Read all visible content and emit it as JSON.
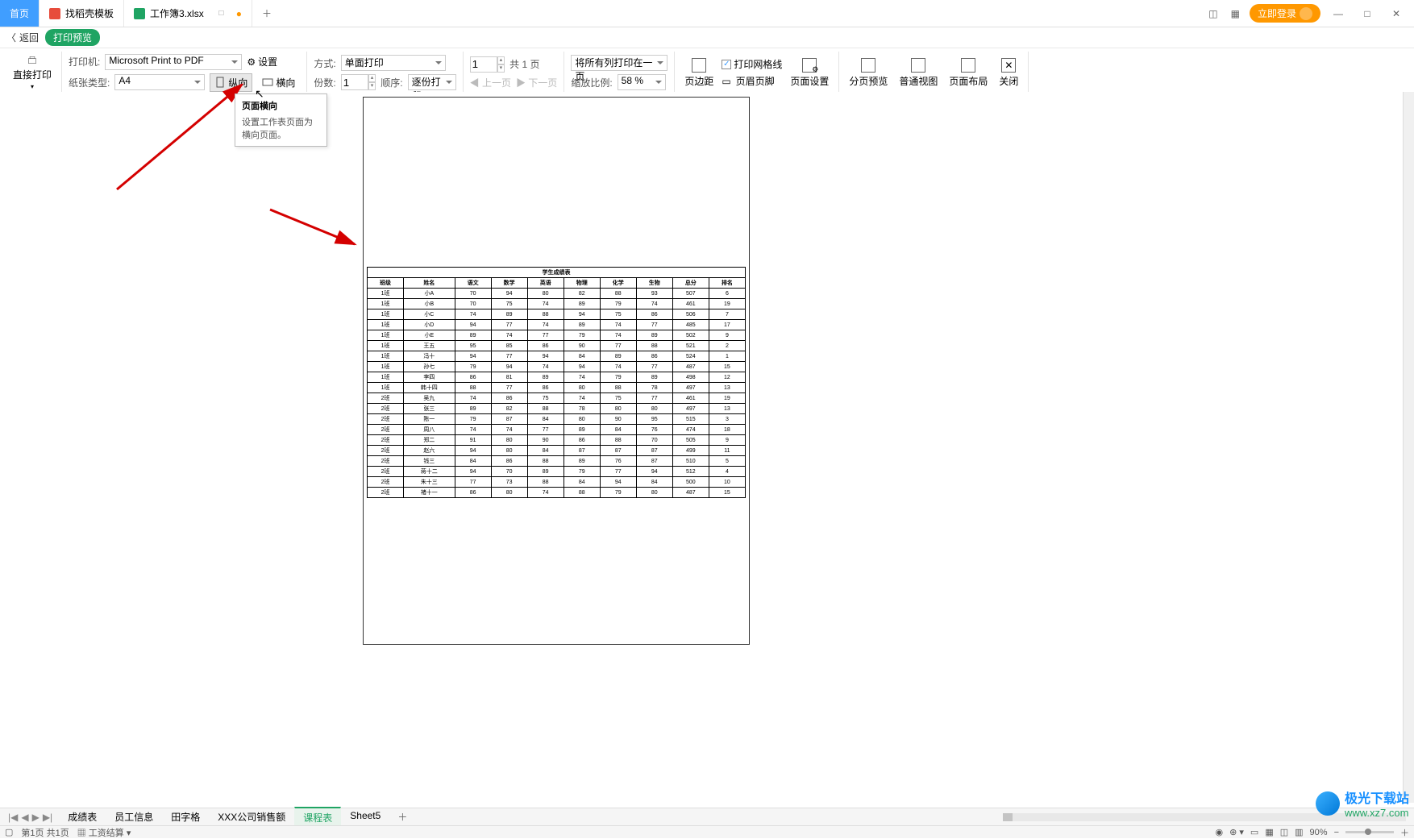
{
  "tabs": {
    "home": "首页",
    "template": "找稻壳模板",
    "file": "工作簿3.xlsx"
  },
  "titlebar": {
    "login": "立即登录"
  },
  "subbar": {
    "back": "返回",
    "title": "打印预览"
  },
  "toolbar": {
    "direct_print": "直接打印",
    "printer_label": "打印机:",
    "printer_value": "Microsoft Print to PDF",
    "paper_label": "纸张类型:",
    "paper_value": "A4",
    "settings": "设置",
    "portrait": "纵向",
    "landscape": "横向",
    "method_label": "方式:",
    "method_value": "单面打印",
    "copies_label": "份数:",
    "copies_value": "1",
    "order_label": "顺序:",
    "order_value": "逐份打印",
    "page_input": "1",
    "page_total_prefix": "共",
    "page_total": "1",
    "page_total_suffix": "页",
    "prev_page": "上一页",
    "next_page": "下一页",
    "fit_value": "将所有列打印在一页",
    "zoom_label": "缩放比例:",
    "zoom_value": "58 %",
    "margins": "页边距",
    "header_footer": "页眉页脚",
    "page_setup": "页面设置",
    "print_grid": "打印网格线",
    "page_break": "分页预览",
    "normal_view": "普通视图",
    "page_layout": "页面布局",
    "close": "关闭"
  },
  "tooltip": {
    "title": "页面横向",
    "body": "设置工作表页面为横向页面。"
  },
  "sheet_tabs": [
    "成绩表",
    "员工信息",
    "田字格",
    "XXX公司销售额",
    "课程表",
    "Sheet5"
  ],
  "status": {
    "page_info": "第1页  共1页",
    "salary": "工资结算",
    "zoom": "90%"
  },
  "watermark": {
    "t1": "极光下载站",
    "t2": "www.xz7.com"
  },
  "table": {
    "title": "学生成绩表",
    "headers": [
      "班级",
      "姓名",
      "语文",
      "数学",
      "英语",
      "物理",
      "化学",
      "生物",
      "总分",
      "排名"
    ],
    "rows": [
      [
        "1班",
        "小A",
        "70",
        "94",
        "80",
        "82",
        "88",
        "93",
        "507",
        "6"
      ],
      [
        "1班",
        "小B",
        "70",
        "75",
        "74",
        "89",
        "79",
        "74",
        "461",
        "19"
      ],
      [
        "1班",
        "小C",
        "74",
        "89",
        "88",
        "94",
        "75",
        "86",
        "506",
        "7"
      ],
      [
        "1班",
        "小D",
        "94",
        "77",
        "74",
        "89",
        "74",
        "77",
        "485",
        "17"
      ],
      [
        "1班",
        "小E",
        "89",
        "74",
        "77",
        "79",
        "74",
        "89",
        "502",
        "9"
      ],
      [
        "1班",
        "王五",
        "95",
        "85",
        "86",
        "90",
        "77",
        "88",
        "521",
        "2"
      ],
      [
        "1班",
        "冯十",
        "94",
        "77",
        "94",
        "84",
        "89",
        "86",
        "524",
        "1"
      ],
      [
        "1班",
        "孙七",
        "79",
        "94",
        "74",
        "94",
        "74",
        "77",
        "487",
        "15"
      ],
      [
        "1班",
        "李四",
        "86",
        "81",
        "89",
        "74",
        "79",
        "89",
        "498",
        "12"
      ],
      [
        "1班",
        "韩十四",
        "88",
        "77",
        "86",
        "80",
        "88",
        "78",
        "497",
        "13"
      ],
      [
        "2班",
        "吴九",
        "74",
        "86",
        "75",
        "74",
        "75",
        "77",
        "461",
        "19"
      ],
      [
        "2班",
        "张三",
        "89",
        "82",
        "88",
        "78",
        "80",
        "80",
        "497",
        "13"
      ],
      [
        "2班",
        "陈一",
        "79",
        "87",
        "84",
        "80",
        "90",
        "95",
        "515",
        "3"
      ],
      [
        "2班",
        "周八",
        "74",
        "74",
        "77",
        "89",
        "84",
        "76",
        "474",
        "18"
      ],
      [
        "2班",
        "郑二",
        "91",
        "80",
        "90",
        "86",
        "88",
        "70",
        "505",
        "9"
      ],
      [
        "2班",
        "赵六",
        "94",
        "80",
        "84",
        "87",
        "87",
        "87",
        "499",
        "11"
      ],
      [
        "2班",
        "钱三",
        "84",
        "86",
        "88",
        "89",
        "76",
        "87",
        "510",
        "5"
      ],
      [
        "2班",
        "蒋十二",
        "94",
        "70",
        "89",
        "79",
        "77",
        "94",
        "512",
        "4"
      ],
      [
        "2班",
        "朱十三",
        "77",
        "73",
        "88",
        "84",
        "94",
        "84",
        "500",
        "10"
      ],
      [
        "2班",
        "褚十一",
        "86",
        "80",
        "74",
        "88",
        "79",
        "80",
        "487",
        "15"
      ]
    ]
  }
}
